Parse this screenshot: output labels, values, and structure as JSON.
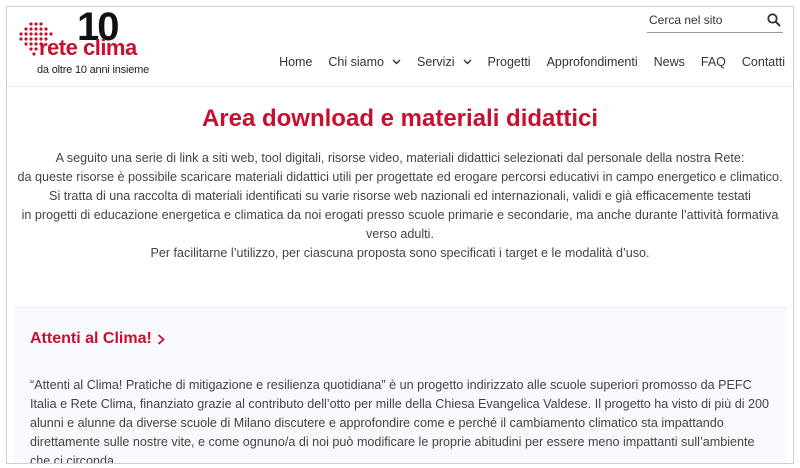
{
  "header": {
    "logo": {
      "number": "10",
      "brand": "rete clima",
      "tagline": "da oltre 10 anni insieme"
    },
    "search": {
      "placeholder": "Cerca nel sito",
      "icon": "search-icon"
    },
    "nav": {
      "home": "Home",
      "chi_siamo": "Chi siamo",
      "servizi": "Servizi",
      "progetti": "Progetti",
      "approfondimenti": "Approfondimenti",
      "news": "News",
      "faq": "FAQ",
      "contatti": "Contatti"
    }
  },
  "main": {
    "title": "Area download e materiali didattici",
    "intro": [
      "A seguito una serie di link a siti web, tool digitali, risorse video, materiali didattici selezionati dal personale della nostra Rete:",
      "da queste risorse è possibile scaricare materiali didattici utili per progettate ed erogare percorsi educativi in campo energetico e climatico.",
      "Si tratta di una raccolta di materiali identificati su varie risorse web nazionali ed internazionali, validi e già efficacemente testati",
      "in progetti di educazione energetica e climatica da noi erogati presso scuole primarie e secondarie, ma anche durante l’attività formativa verso adulti.",
      "Per facilitarne l’utilizzo, per ciascuna proposta sono specificati i target e le modalità d’uso."
    ],
    "card": {
      "title": "Attenti al Clima!",
      "text": "“Attenti al Clima! Pratiche di mitigazione e resilienza quotidiana” è un progetto indirizzato alle scuole superiori promosso da PEFC Italia e Rete Clima, finanziato grazie al contributo dell’otto per mille della Chiesa Evangelica Valdese. Il progetto ha visto di più di 200 alunni e alunne da diverse scuole di Milano discutere e approfondire come e perché il cambiamento climatico sta impattando direttamente sulle nostre vite, e come ognuno/a di noi può modificare le proprie abitudini per essere meno impattanti sull’ambiente che ci circonda."
    }
  },
  "colors": {
    "accent": "#c8102e",
    "text": "#444444",
    "card_bg": "#f7f9fc"
  }
}
